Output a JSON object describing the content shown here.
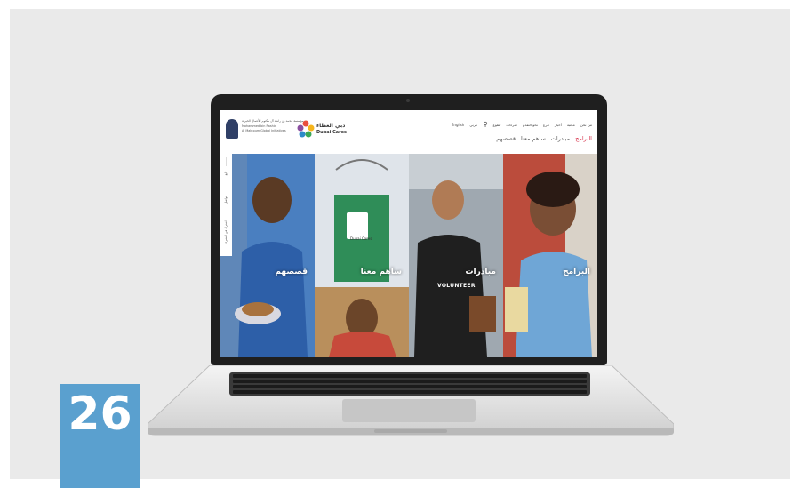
{
  "page_number": "26",
  "website": {
    "logo_mbr": {
      "line_1": "مؤسسة محمد بن راشد آل مكتوم للأعمال الخيرية",
      "line_2": "Mohammed bin Rashid",
      "line_3": "Al Maktoum Global Initiatives"
    },
    "logo_dubai_cares": {
      "arabic": "دبي العطاء",
      "english": "Dubai Cares"
    },
    "top_links": [
      "من نحن",
      "مكتبة",
      "أخبار",
      "تبرع",
      "نحو التقدم",
      "شركات",
      "تطوع"
    ],
    "search_icon": "search-icon",
    "topbar_extra": [
      "عربي",
      "English"
    ],
    "main_nav": [
      "البرامج",
      "مبادرات",
      "ساهم معنا",
      "قصصهم"
    ],
    "sidebar_items": [
      "تابع",
      "تواصل",
      "اشترك في النشرة"
    ],
    "panels": [
      {
        "label": "قصصهم"
      },
      {
        "label": "ساهم معنا",
        "bucket_text": "Dubai Cares"
      },
      {
        "label": "مبادرات",
        "shirt_text": "VOLUNTEER"
      },
      {
        "label": "البرامج"
      }
    ],
    "colors": {
      "accent": "#d8354e",
      "nav_text": "#555555",
      "badge": "#5aa0cf"
    }
  }
}
